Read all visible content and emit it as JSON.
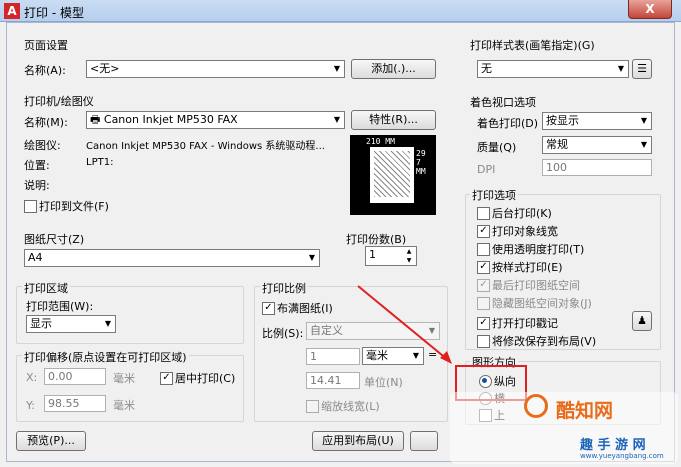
{
  "window": {
    "title": "打印 - 模型",
    "app_icon": "A",
    "close_label": "X"
  },
  "page_setup": {
    "label": "页面设置",
    "name_label": "名称(A):",
    "name_value": "<无>",
    "add_button": "添加(.)..."
  },
  "printer": {
    "label": "打印机/绘图仪",
    "name_label": "名称(M):",
    "name_value": "Canon Inkjet MP530 FAX",
    "properties_button": "特性(R)...",
    "plotter_label": "绘图仪:",
    "plotter_value": "Canon Inkjet MP530 FAX - Windows 系统驱动程...",
    "location_label": "位置:",
    "location_value": "LPT1:",
    "description_label": "说明:",
    "print_to_file": "打印到文件(F)",
    "paper_width": "210 MM",
    "paper_height": "297 MM"
  },
  "paper_size": {
    "label": "图纸尺寸(Z)",
    "value": "A4"
  },
  "copies": {
    "label": "打印份数(B)",
    "value": "1"
  },
  "plot_area": {
    "label": "打印区域",
    "range_label": "打印范围(W):",
    "range_value": "显示"
  },
  "plot_offset": {
    "label": "打印偏移(原点设置在可打印区域)",
    "x_label": "X:",
    "x_value": "0.00",
    "x_unit": "毫米",
    "y_label": "Y:",
    "y_value": "98.55",
    "y_unit": "毫米",
    "center_label": "居中打印(C)"
  },
  "plot_scale": {
    "label": "打印比例",
    "fit_label": "布满图纸(I)",
    "scale_label": "比例(S):",
    "scale_value": "自定义",
    "value1": "1",
    "unit_value": "毫米",
    "equals": "=",
    "value2": "14.41",
    "unit2_label": "单位(N)",
    "lineweights_label": "缩放线宽(L)"
  },
  "plot_style": {
    "label": "打印样式表(画笔指定)(G)",
    "value": "无"
  },
  "shaded": {
    "label": "着色视口选项",
    "shade_label": "着色打印(D)",
    "shade_value": "按显示",
    "quality_label": "质量(Q)",
    "quality_value": "常规",
    "dpi_label": "DPI",
    "dpi_value": "100"
  },
  "plot_options": {
    "label": "打印选项",
    "items": [
      {
        "label": "后台打印(K)",
        "checked": false,
        "enabled": true
      },
      {
        "label": "打印对象线宽",
        "checked": true,
        "enabled": true
      },
      {
        "label": "使用透明度打印(T)",
        "checked": false,
        "enabled": true
      },
      {
        "label": "按样式打印(E)",
        "checked": true,
        "enabled": true
      },
      {
        "label": "最后打印图纸空间",
        "checked": true,
        "enabled": false
      },
      {
        "label": "隐藏图纸空间对象(J)",
        "checked": false,
        "enabled": false
      },
      {
        "label": "打开打印戳记",
        "checked": true,
        "enabled": true
      },
      {
        "label": "将修改保存到布局(V)",
        "checked": false,
        "enabled": true
      }
    ]
  },
  "orientation": {
    "label": "图形方向",
    "portrait": "纵向",
    "landscape": "横",
    "upside": "上"
  },
  "footer": {
    "preview_button": "预览(P)...",
    "apply_button": "应用到布局(U)"
  },
  "watermark": {
    "text1": "酷知网",
    "text2": "趣 手 游 网",
    "url": "www.yueyangbang.com"
  },
  "colors": {
    "annotation_red": "#e02020",
    "title_bg": "#c9dcf2"
  }
}
